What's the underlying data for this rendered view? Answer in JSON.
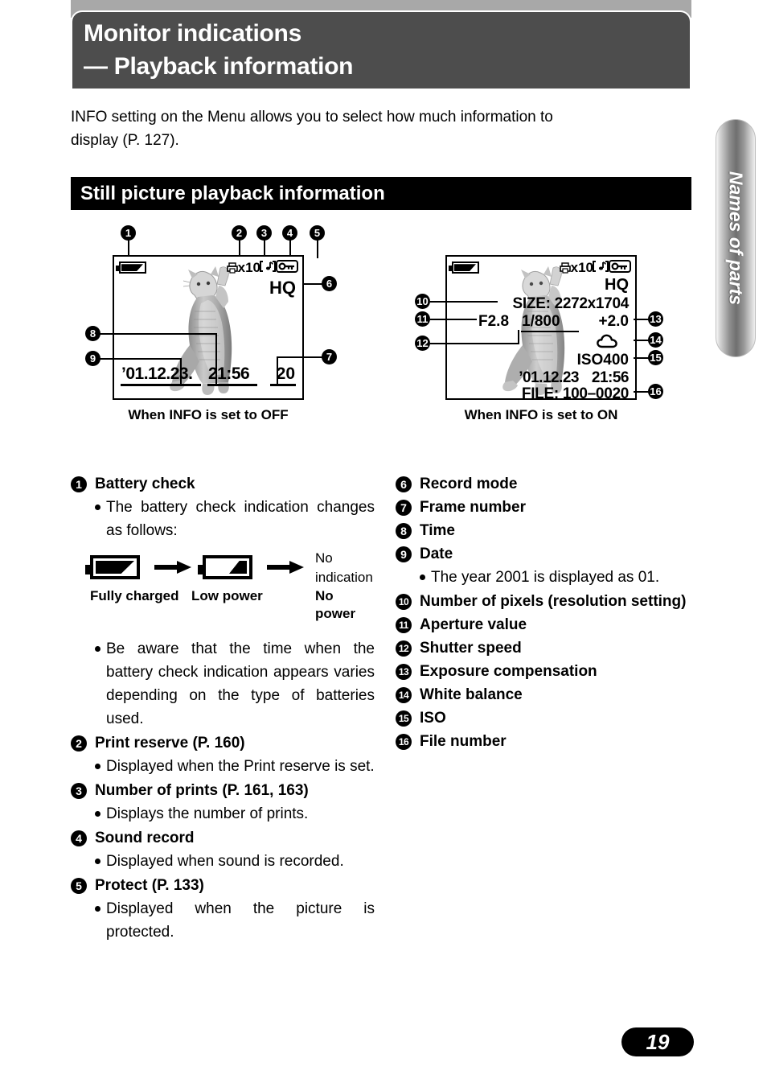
{
  "header": {
    "title": "Monitor indications\n— Playback information",
    "bg_color": "#4d4d4d"
  },
  "intro": {
    "line1": "INFO setting on the Menu allows you to select how much information to",
    "line2": "display (P. 127)."
  },
  "section": {
    "title": "Still picture playback information"
  },
  "diagram": {
    "left_screen": {
      "caption": "When INFO is set to OFF",
      "callouts": [
        "1",
        "2",
        "3",
        "4",
        "5",
        "6",
        "7",
        "8",
        "9"
      ],
      "osd": {
        "battery_icon": "battery-full-icon",
        "print_icon": "printer-icon",
        "print_count": "x10",
        "sound_icon": "sound-note-icon",
        "protect_icon": "key-protect-icon",
        "record_mode": "HQ",
        "date": "’01.12.23.",
        "time": "21:56",
        "frame_number": "20"
      }
    },
    "right_screen": {
      "caption": "When INFO is set to ON",
      "callouts": [
        "10",
        "11",
        "12",
        "13",
        "14",
        "15",
        "16"
      ],
      "osd": {
        "battery_icon": "battery-full-icon",
        "print_icon": "printer-icon",
        "print_count": "x10",
        "sound_icon": "sound-note-icon",
        "protect_icon": "key-protect-icon",
        "record_mode": "HQ",
        "size": "SIZE: 2272x1704",
        "aperture": "F2.8",
        "shutter": "1/800",
        "exposure": "+2.0",
        "white_balance_icon": "cloud-icon",
        "iso": "ISO400",
        "date": "’01.12.23",
        "time": "21:56",
        "file": "FILE: 100–0020"
      }
    }
  },
  "left_column": [
    {
      "num": "1",
      "title": "Battery check",
      "subs": [
        "The battery check indication changes as follows:"
      ],
      "battery_diagram": {
        "states": [
          {
            "icon": "battery-full-icon",
            "label": "Fully\ncharged"
          },
          {
            "icon": "battery-low-icon",
            "label": "Low power"
          },
          {
            "icon": "no-indication-text",
            "label": "No power",
            "value": "No\nindication"
          }
        ]
      },
      "subs_after": [
        "Be aware that the time when the battery check indication appears varies depending on the type of batteries used."
      ]
    },
    {
      "num": "2",
      "title": "Print reserve (P. 160)",
      "subs": [
        "Displayed when the Print reserve is set."
      ]
    },
    {
      "num": "3",
      "title": "Number of prints (P. 161, 163)",
      "subs": [
        "Displays the number of prints."
      ]
    },
    {
      "num": "4",
      "title": "Sound record",
      "subs": [
        "Displayed when sound is recorded."
      ]
    },
    {
      "num": "5",
      "title": "Protect (P. 133)",
      "subs": [
        "Displayed when the picture is protected."
      ]
    }
  ],
  "right_column": [
    {
      "num": "6",
      "title": "Record mode",
      "subs": []
    },
    {
      "num": "7",
      "title": "Frame number",
      "subs": []
    },
    {
      "num": "8",
      "title": "Time",
      "subs": []
    },
    {
      "num": "9",
      "title": "Date",
      "subs": [
        "The year 2001 is displayed as 01."
      ]
    },
    {
      "num": "10",
      "title": "Number of pixels (resolution setting)",
      "subs": []
    },
    {
      "num": "11",
      "title": "Aperture value",
      "subs": []
    },
    {
      "num": "12",
      "title": "Shutter speed",
      "subs": []
    },
    {
      "num": "13",
      "title": "Exposure compensation",
      "subs": []
    },
    {
      "num": "14",
      "title": "White balance",
      "subs": []
    },
    {
      "num": "15",
      "title": "ISO",
      "subs": []
    },
    {
      "num": "16",
      "title": "File number",
      "subs": []
    }
  ],
  "side_tab": {
    "label": "Names of parts"
  },
  "page_number": "19"
}
